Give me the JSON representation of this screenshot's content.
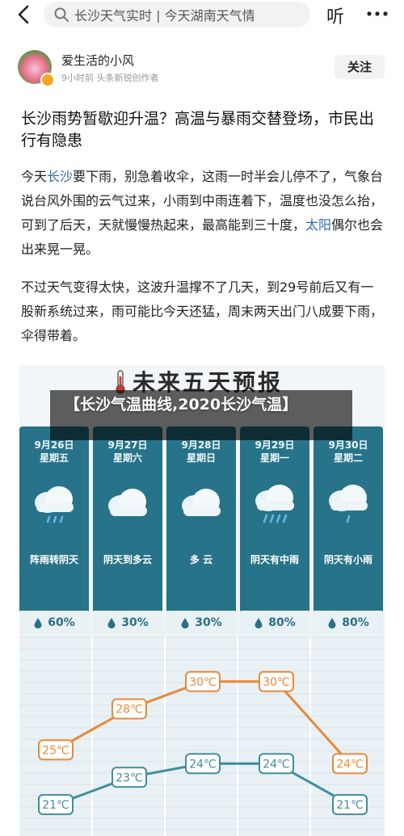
{
  "search": {
    "query": "长沙天气实时 | 今天湖南天气情"
  },
  "topbar": {
    "listen_label": "听"
  },
  "author": {
    "name": "爱生活的小风",
    "meta": "9小时前  头条新锐创作者",
    "follow_label": "关注"
  },
  "article": {
    "title": "长沙雨势暂歇迎升温？高温与暴雨交替登场，市民出行有隐患",
    "p1_a": "今天",
    "p1_link1": "长沙",
    "p1_b": "要下雨，别急着收伞，这雨一时半会儿停不了，气象台说台风外围的云气过来，小雨到中雨连着下，温度也没怎么抬，可到了后天，天就慢慢热起来，最高能到三十度，",
    "p1_link2": "太阳",
    "p1_c": "偶尔也会出来晃一晃。",
    "p2": "不过天气变得太快，这波升温撑不了几天，到29号前后又有一股新系统过来，雨可能比今天还猛，周末两天出门八成要下雨，伞得带着。"
  },
  "forecast": {
    "title": "未来五天预报",
    "days": [
      {
        "date": "9月26日",
        "weekday": "星期五",
        "condition": "阵雨转阴天",
        "rain": "60%",
        "icon": "cloud-rain-icon"
      },
      {
        "date": "9月27日",
        "weekday": "星期六",
        "condition": "阴天到多云",
        "rain": "30%",
        "icon": "cloud-icon"
      },
      {
        "date": "9月28日",
        "weekday": "星期日",
        "condition": "多  云",
        "rain": "30%",
        "icon": "cloud-icon"
      },
      {
        "date": "9月29日",
        "weekday": "星期一",
        "condition": "阴天有中雨",
        "rain": "80%",
        "icon": "cloud-heavy-rain-icon"
      },
      {
        "date": "9月30日",
        "weekday": "星期二",
        "condition": "阴天有小雨",
        "rain": "80%",
        "icon": "cloud-light-rain-icon"
      }
    ],
    "colors": {
      "column": "#27738a",
      "high_line": "#e8893a",
      "low_line": "#3e8e9e"
    }
  },
  "chart_data": {
    "type": "line",
    "categories": [
      "9月26日",
      "9月27日",
      "9月28日",
      "9月29日",
      "9月30日"
    ],
    "series": [
      {
        "values": [
          25,
          28,
          30,
          30,
          24
        ],
        "labels": [
          "25℃",
          "28℃",
          "30℃",
          "30℃",
          "24℃"
        ]
      },
      {
        "values": [
          21,
          23,
          24,
          24,
          21
        ],
        "labels": [
          "21℃",
          "23℃",
          "24℃",
          "24℃",
          "21℃"
        ]
      }
    ],
    "ylim": [
      19,
      33
    ],
    "grid": true
  },
  "overlay": {
    "text": "【长沙气温曲线,2020长沙气温】"
  }
}
